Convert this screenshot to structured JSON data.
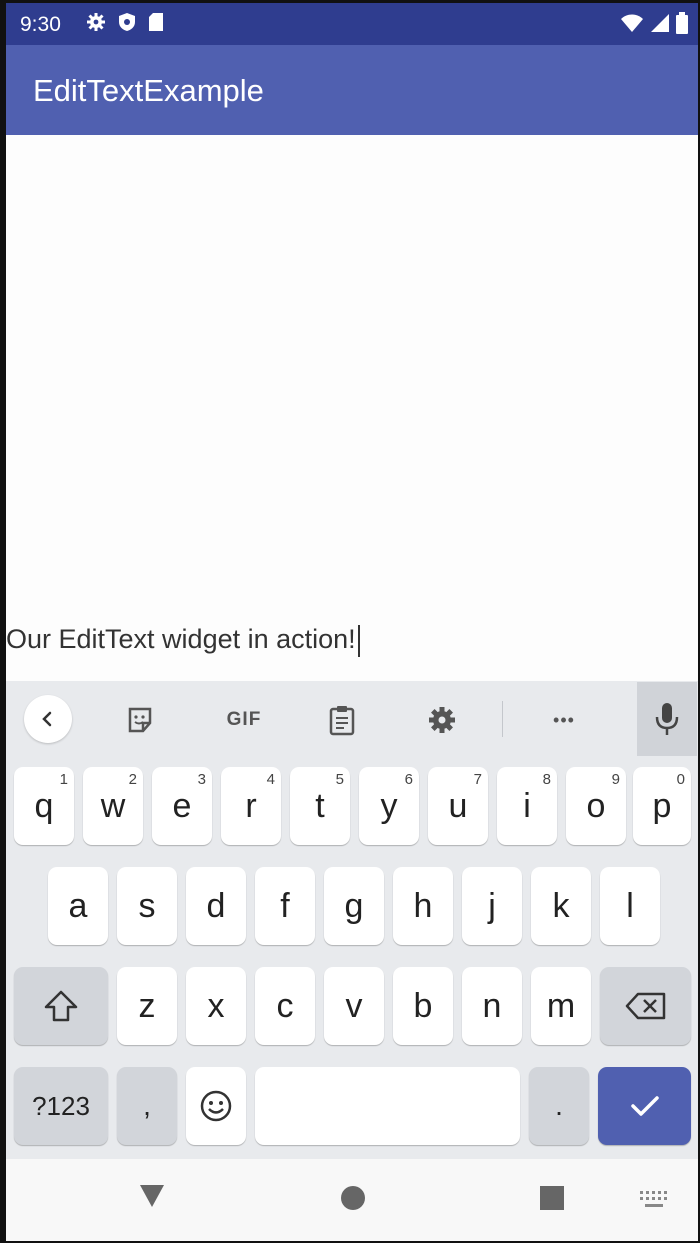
{
  "status_bar": {
    "time": "9:30",
    "icons_left": [
      "gear-icon",
      "shield-icon",
      "sd-card-icon"
    ],
    "icons_right": [
      "wifi-icon",
      "signal-icon",
      "battery-icon"
    ],
    "background": "#2f3d8f"
  },
  "app_bar": {
    "title": "EditTextExample",
    "background": "#5060b0"
  },
  "edit_text": {
    "value": "Our EditText widget in action!"
  },
  "keyboard": {
    "toolbar": {
      "items": [
        "chevron-left-icon",
        "sticker-icon",
        "gif-button",
        "clipboard-icon",
        "gear-icon",
        "more-icon",
        "mic-icon"
      ],
      "gif_label": "GIF",
      "more_label": "•••"
    },
    "row1": [
      {
        "label": "q",
        "sup": "1"
      },
      {
        "label": "w",
        "sup": "2"
      },
      {
        "label": "e",
        "sup": "3"
      },
      {
        "label": "r",
        "sup": "4"
      },
      {
        "label": "t",
        "sup": "5"
      },
      {
        "label": "y",
        "sup": "6"
      },
      {
        "label": "u",
        "sup": "7"
      },
      {
        "label": "i",
        "sup": "8"
      },
      {
        "label": "o",
        "sup": "9"
      },
      {
        "label": "p",
        "sup": "0"
      }
    ],
    "row2": [
      "a",
      "s",
      "d",
      "f",
      "g",
      "h",
      "j",
      "k",
      "l"
    ],
    "row3": [
      "z",
      "x",
      "c",
      "v",
      "b",
      "n",
      "m"
    ],
    "symbols_label": "?123",
    "comma_label": ",",
    "period_label": ".",
    "accent_color": "#5060b0"
  },
  "nav_bar": {
    "icons": [
      "back-triangle-icon",
      "home-circle-icon",
      "recents-square-icon",
      "keyboard-switch-icon"
    ]
  }
}
